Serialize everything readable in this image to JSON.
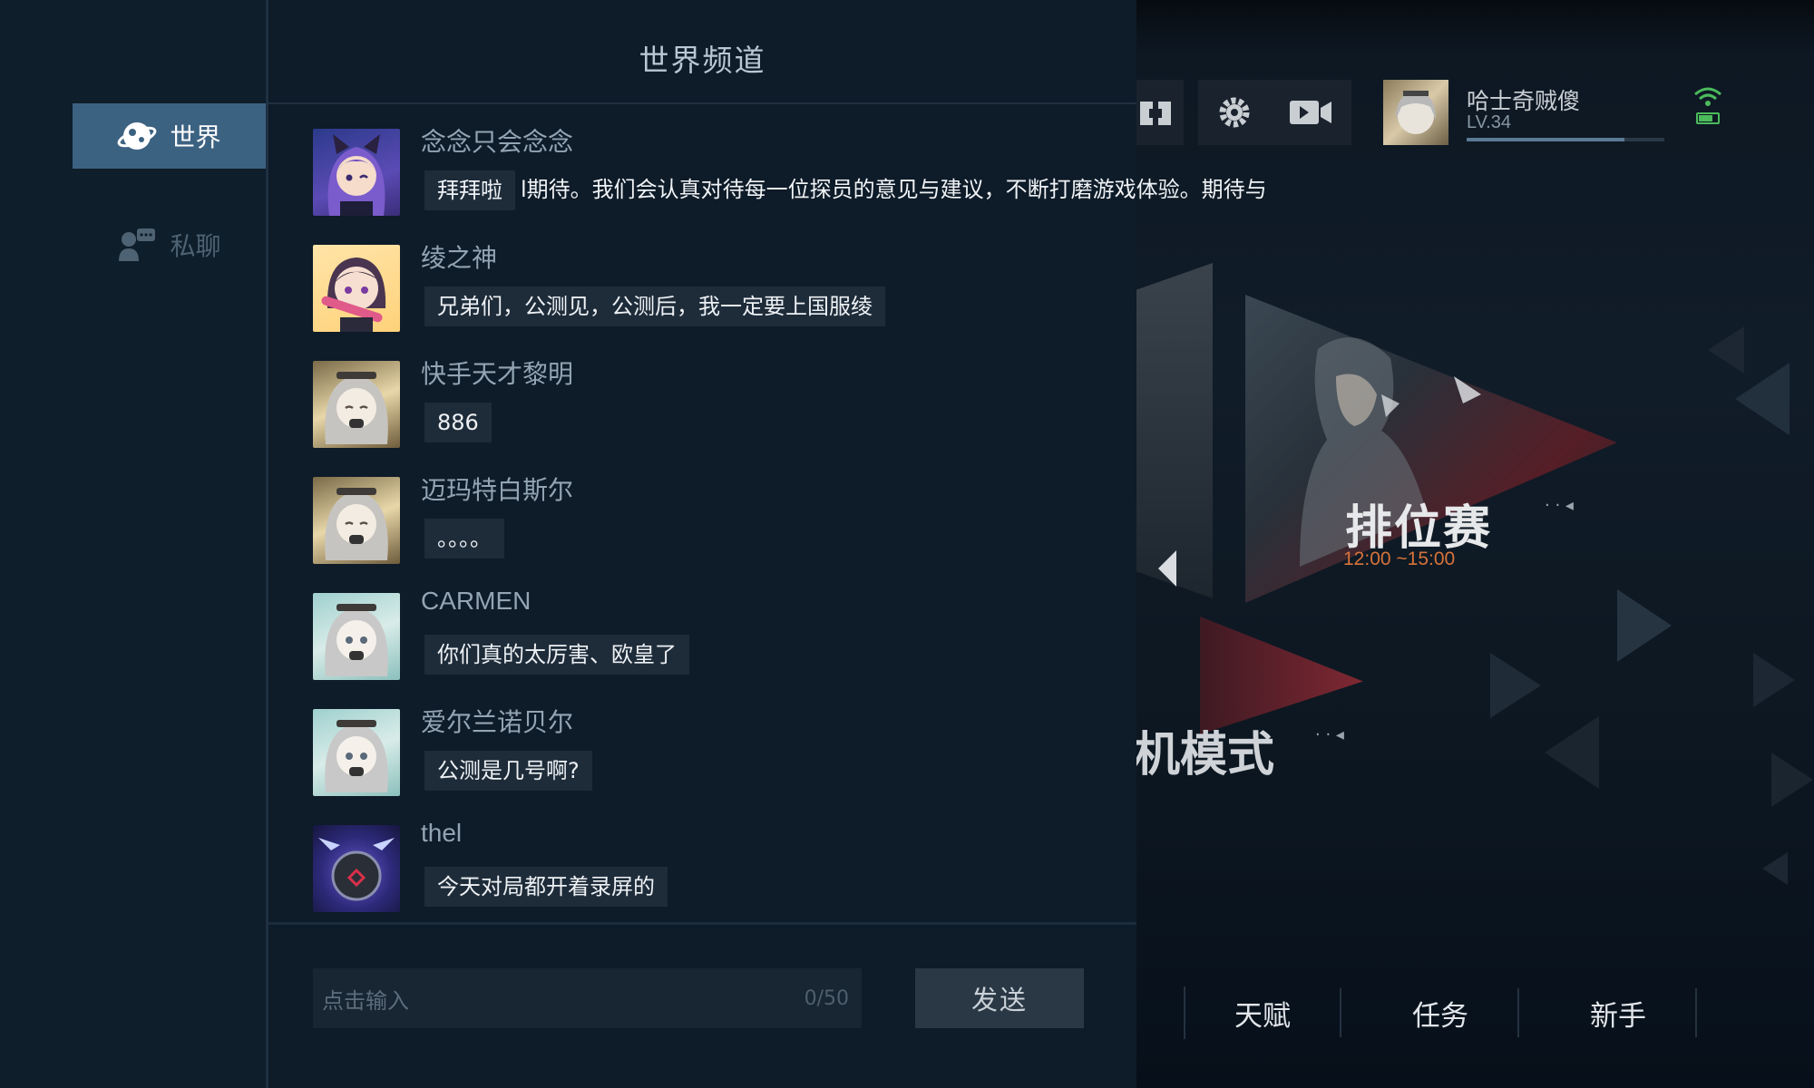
{
  "nav": {
    "world_label": "世界",
    "private_label": "私聊"
  },
  "chat": {
    "title": "世界频道",
    "overflow_message": "l期待。我们会认真对待每一位探员的意见与建议，不断打磨游戏体验。期待与",
    "messages": [
      {
        "name": "念念只会念念",
        "text": "拜拜啦",
        "avatar": "purple-haired-girl-avatar"
      },
      {
        "name": "绫之神",
        "text": "兄弟们，公测见，公测后，我一定要上国服绫",
        "avatar": "dark-haired-girl-avatar"
      },
      {
        "name": "快手天才黎明",
        "text": "886",
        "avatar": "silver-haired-maid-avatar"
      },
      {
        "name": "迈玛特白斯尔",
        "text": "。。。。",
        "avatar": "silver-haired-maid-avatar"
      },
      {
        "name": "CARMEN",
        "text": "你们真的太厉害、欧皇了",
        "avatar": "silver-haired-maid-teal-avatar"
      },
      {
        "name": "爱尔兰诺贝尔",
        "text": "公测是几号啊?",
        "avatar": "silver-haired-maid-teal-avatar"
      },
      {
        "name": "thel",
        "text": "今天对局都开着录屏的",
        "avatar": "dark-orb-avatar"
      }
    ],
    "input_placeholder": "点击输入",
    "input_counter": "0/50",
    "send_label": "发送"
  },
  "lobby": {
    "player_name": "哈士奇贼傻",
    "player_level": "LV.34",
    "level_progress": 0.8,
    "ranked_label": "排位赛",
    "ranked_time": "12:00 ~15:00",
    "mode_label": "机模式",
    "tabs": [
      "天赋",
      "任务",
      "新手"
    ],
    "accent_orange": "#d8733a"
  }
}
